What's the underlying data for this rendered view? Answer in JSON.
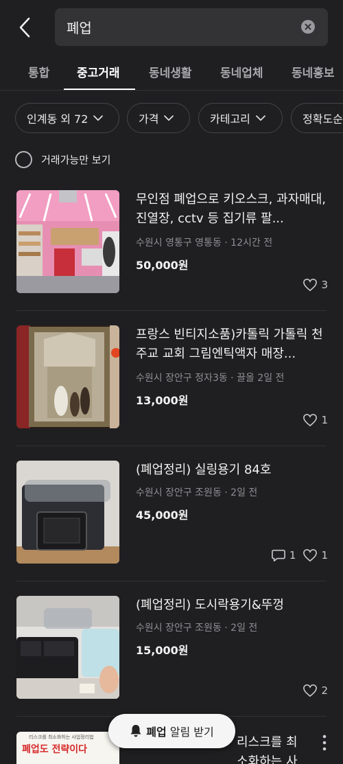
{
  "search": {
    "query": "폐업"
  },
  "tabs": [
    {
      "label": "통합"
    },
    {
      "label": "중고거래"
    },
    {
      "label": "동네생활"
    },
    {
      "label": "동네업체"
    },
    {
      "label": "동네홍보"
    }
  ],
  "filters": [
    {
      "label": "인계동 외 72"
    },
    {
      "label": "가격"
    },
    {
      "label": "카테고리"
    },
    {
      "label": "정확도순"
    }
  ],
  "available_only": {
    "label": "거래가능만 보기"
  },
  "listings": [
    {
      "title": "무인점 폐업으로 키오스크, 과자매대, 진열장, cctv 등 집기류 팔...",
      "meta": "수원시 영통구 영통동 · 12시간 전",
      "price": "50,000원",
      "likes": "3",
      "comments": ""
    },
    {
      "title": "프랑스 빈티지소품)카톨릭 가톨릭 천주교 교회 그림엔틱액자 매장...",
      "meta": "수원시 장안구 정자3동 · 끌올 2일 전",
      "price": "13,000원",
      "likes": "1",
      "comments": ""
    },
    {
      "title": "(폐업정리) 실링용기 84호",
      "meta": "수원시 장안구 조원동 · 2일 전",
      "price": "45,000원",
      "likes": "1",
      "comments": "1"
    },
    {
      "title": "(폐업정리) 도시락용기&뚜껑",
      "meta": "수원시 장안구 조원동 · 2일 전",
      "price": "15,000원",
      "likes": "2",
      "comments": ""
    },
    {
      "title": "리스크를 최소화하는 사업정리법",
      "thumb_text_1": "폐업도 전략이다",
      "thumb_text_2": "리스크를 최소화하는 사업정리법"
    }
  ],
  "notify": {
    "keyword": "폐업",
    "rest": "알림 받기"
  },
  "colors": {
    "background": "#1f1f21",
    "search_bg": "#333336",
    "chip_border": "#45454a",
    "notify_bg": "#f5f5f5"
  }
}
